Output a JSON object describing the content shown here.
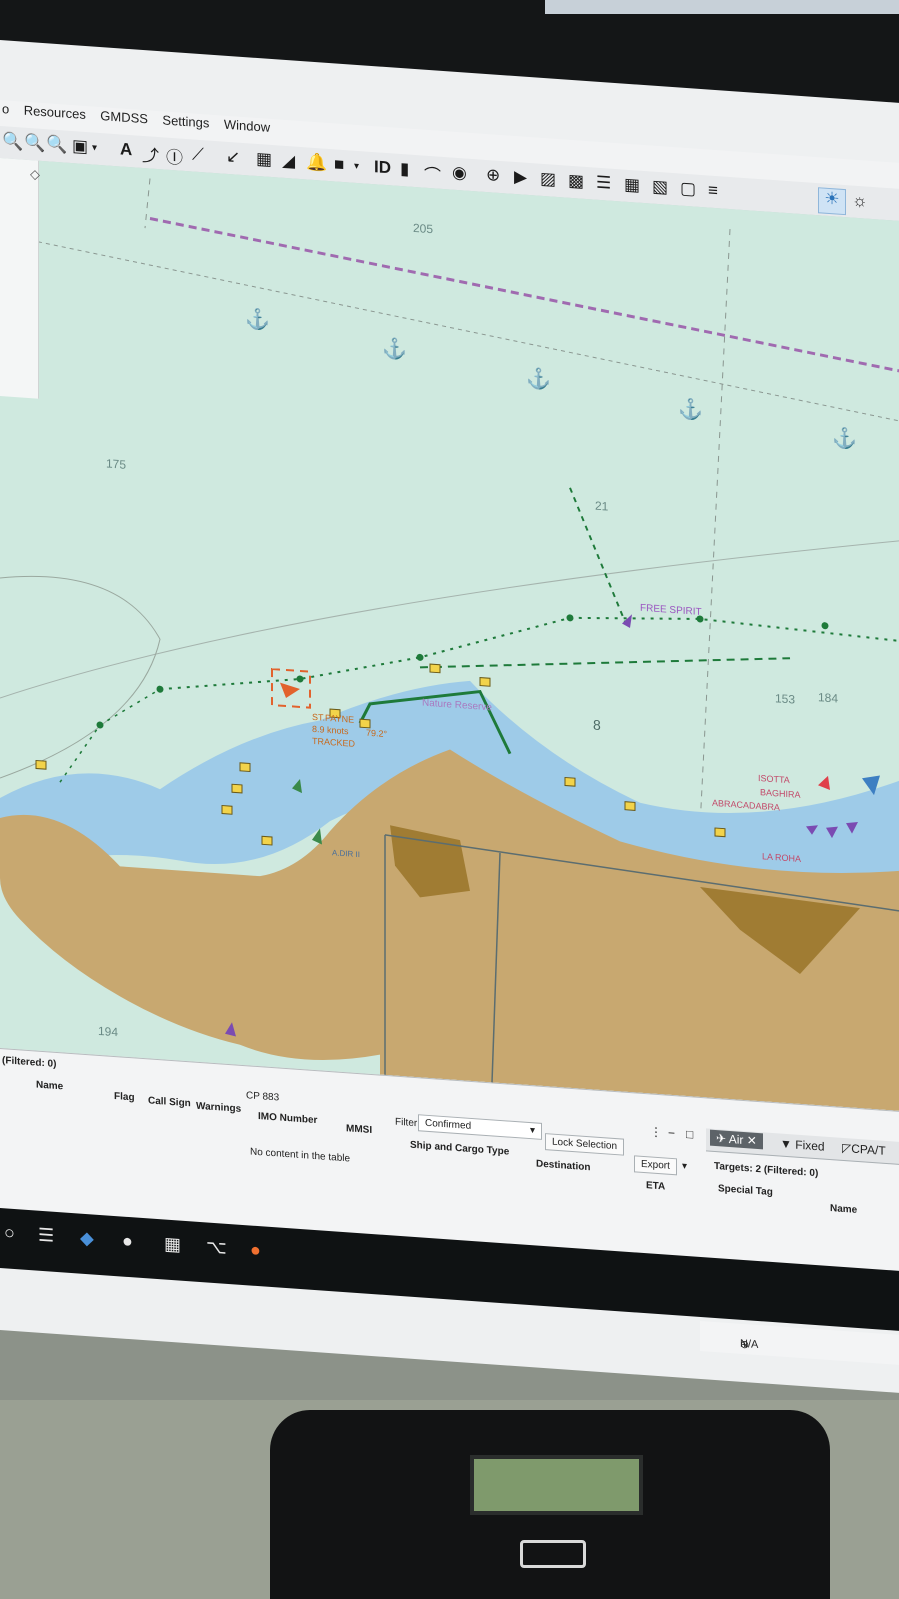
{
  "menu": {
    "items": [
      "Resources",
      "GMDSS",
      "Settings",
      "Window"
    ],
    "partial_left": "o"
  },
  "toolbar": {
    "a_label": "A",
    "id_label": "ID"
  },
  "chart": {
    "depth_labels": [
      "205",
      "21",
      "175",
      "153",
      "184",
      "8",
      "194"
    ],
    "vessel_labels": {
      "free_spirit": "FREE SPIRIT",
      "isotta": "ISOTTA",
      "baghira": "BAGHIRA",
      "abracadabra": "ABRACADABRA",
      "la_roha": "LA ROHA",
      "tracked": "TRACKED",
      "speed": "8.9 knots",
      "heading": "79.2°",
      "vessel_name_trunc": "ST.PAYNE",
      "adir": "A.DIR II",
      "nature_reserve": "Nature Reserve"
    },
    "colors": {
      "sea": "#cfe9df",
      "shallow": "#9ecbe8",
      "land": "#c8a870",
      "land_dark": "#a07c33",
      "route": "#1e7a3a",
      "boundary_dashed": "#a06ab0",
      "marker": "#f2d34a"
    }
  },
  "bottom": {
    "filtered_label": "(Filtered: 0)",
    "columns_row1": [
      "Name",
      "Flag",
      "Call Sign",
      "Warnings",
      "IMO Number",
      "MMSI"
    ],
    "cp_label": "CP 883",
    "filter_label": "Filter",
    "filter_value": "Confirmed",
    "ship_cargo_col": "Ship and Cargo Type",
    "lock_selection": "Lock Selection",
    "destination_col": "Destination",
    "export_btn": "Export",
    "eta_col": "ETA",
    "empty_message": "No content in the table",
    "tabs": [
      "Air",
      "Fixed",
      "CPA/T"
    ],
    "targets_label": "Targets: 2 (Filtered: 0)",
    "special_tag_col": "Special Tag",
    "name_col": "Name"
  },
  "status": {
    "coords": "N/A"
  }
}
